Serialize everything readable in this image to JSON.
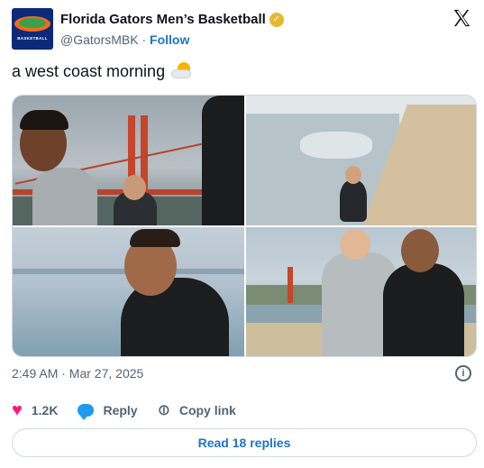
{
  "account": {
    "display_name": "Florida Gators Men’s Basketball",
    "handle": "@GatorsMBK",
    "separator": "·",
    "follow_label": "Follow",
    "avatar_text": "BASKETBALL",
    "verified_icon": "gold-checkmark-badge"
  },
  "tweet": {
    "text": "a west coast morning",
    "emoji_icon": "sun-behind-cloud",
    "timestamp": "2:49 AM · Mar 27, 2025"
  },
  "media": {
    "photo_count": 4
  },
  "actions": {
    "like_count": "1.2K",
    "reply_label": "Reply",
    "copy_link_label": "Copy link"
  },
  "footer": {
    "read_replies_label": "Read 18 replies"
  },
  "colors": {
    "accent_link": "#1d74c7",
    "like_pink": "#f91880",
    "verified_gold": "#e8b830",
    "avatar_blue": "#0b2a7a"
  }
}
